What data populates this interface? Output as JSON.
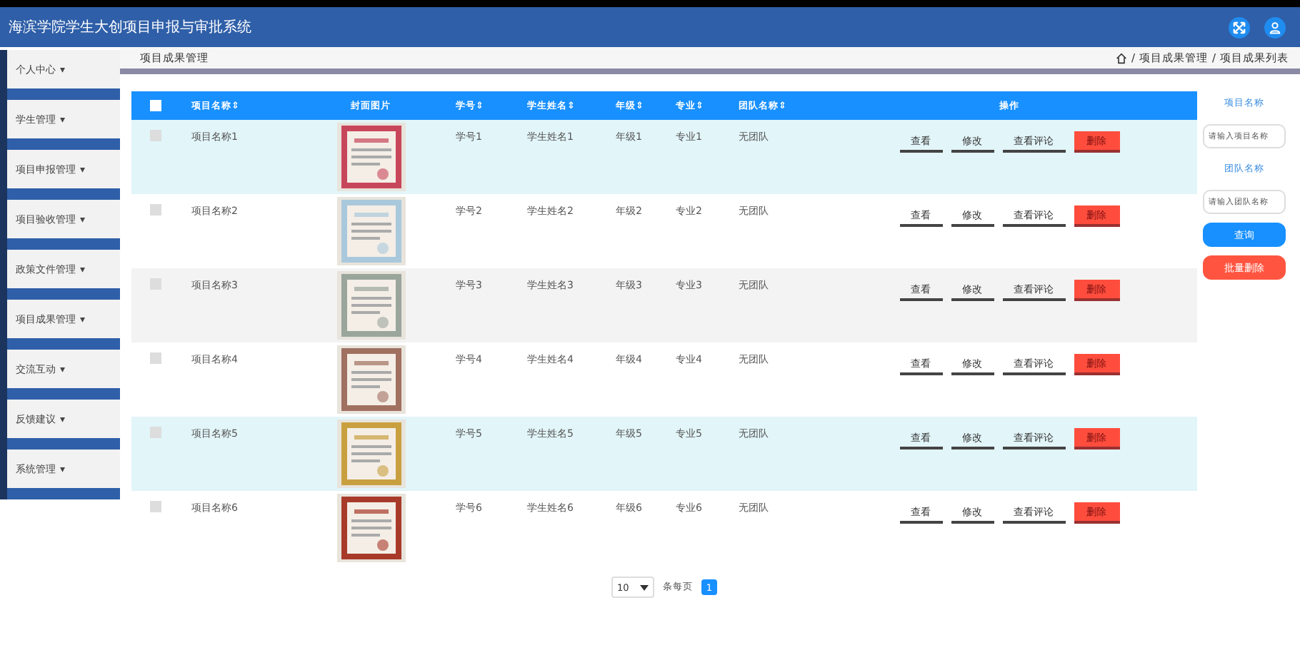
{
  "header": {
    "title": "海滨学院学生大创项目申报与审批系统"
  },
  "sidebar": {
    "items": [
      {
        "label": "个人中心",
        "caret": "▾"
      },
      {
        "label": "学生管理",
        "caret": "▾"
      },
      {
        "label": "项目申报管理",
        "caret": "▾"
      },
      {
        "label": "项目验收管理",
        "caret": "▾"
      },
      {
        "label": "政策文件管理",
        "caret": "▾"
      },
      {
        "label": "项目成果管理",
        "caret": "▾"
      },
      {
        "label": "交流互动",
        "caret": "▾"
      },
      {
        "label": "反馈建议",
        "caret": "▾"
      },
      {
        "label": "系统管理",
        "caret": "▾"
      }
    ]
  },
  "page_title": "项目成果管理",
  "breadcrumb": [
    {
      "separator": "/",
      "label": "项目成果管理"
    },
    {
      "separator": "/",
      "label": "项目成果列表"
    }
  ],
  "table": {
    "select_all_checked": false,
    "sort_mark": "⇕",
    "columns": [
      {
        "label": "项目名称",
        "sortable": true
      },
      {
        "label": "封面图片",
        "sortable": false
      },
      {
        "label": "学号",
        "sortable": true
      },
      {
        "label": "学生姓名",
        "sortable": true
      },
      {
        "label": "年级",
        "sortable": true
      },
      {
        "label": "专业",
        "sortable": true
      },
      {
        "label": "团队名称",
        "sortable": true
      },
      {
        "label": "操作",
        "sortable": false
      }
    ],
    "rows": [
      {
        "checked": false,
        "color": "#e2f5f9",
        "cells": [
          {
            "kind": "text",
            "text": "项目名称1"
          },
          {
            "kind": "picture"
          },
          {
            "kind": "text",
            "text": "学号1"
          },
          {
            "kind": "text",
            "text": "学生姓名1"
          },
          {
            "kind": "text",
            "text": "年级1"
          },
          {
            "kind": "text",
            "text": "专业1"
          },
          {
            "kind": "text",
            "text": "无团队"
          },
          {
            "kind": "actions",
            "buttons": [
              {
                "label": "查看",
                "kind": "plain"
              },
              {
                "label": "修改",
                "kind": "plain"
              },
              {
                "label": "查看评论",
                "kind": "plain"
              },
              {
                "label": "删除",
                "kind": "danger"
              }
            ]
          }
        ]
      },
      {
        "checked": false,
        "color": "#ffffff",
        "cells": [
          {
            "kind": "text",
            "text": "项目名称2"
          },
          {
            "kind": "picture"
          },
          {
            "kind": "text",
            "text": "学号2"
          },
          {
            "kind": "text",
            "text": "学生姓名2"
          },
          {
            "kind": "text",
            "text": "年级2"
          },
          {
            "kind": "text",
            "text": "专业2"
          },
          {
            "kind": "text",
            "text": "无团队"
          },
          {
            "kind": "actions",
            "buttons": [
              {
                "label": "查看",
                "kind": "plain"
              },
              {
                "label": "修改",
                "kind": "plain"
              },
              {
                "label": "查看评论",
                "kind": "plain"
              },
              {
                "label": "删除",
                "kind": "danger"
              }
            ]
          }
        ]
      },
      {
        "checked": false,
        "color": "#f3f3f3",
        "cells": [
          {
            "kind": "text",
            "text": "项目名称3"
          },
          {
            "kind": "picture"
          },
          {
            "kind": "text",
            "text": "学号3"
          },
          {
            "kind": "text",
            "text": "学生姓名3"
          },
          {
            "kind": "text",
            "text": "年级3"
          },
          {
            "kind": "text",
            "text": "专业3"
          },
          {
            "kind": "text",
            "text": "无团队"
          },
          {
            "kind": "actions",
            "buttons": [
              {
                "label": "查看",
                "kind": "plain"
              },
              {
                "label": "修改",
                "kind": "plain"
              },
              {
                "label": "查看评论",
                "kind": "plain"
              },
              {
                "label": "删除",
                "kind": "danger"
              }
            ]
          }
        ]
      },
      {
        "checked": false,
        "color": "#ffffff",
        "cells": [
          {
            "kind": "text",
            "text": "项目名称4"
          },
          {
            "kind": "picture"
          },
          {
            "kind": "text",
            "text": "学号4"
          },
          {
            "kind": "text",
            "text": "学生姓名4"
          },
          {
            "kind": "text",
            "text": "年级4"
          },
          {
            "kind": "text",
            "text": "专业4"
          },
          {
            "kind": "text",
            "text": "无团队"
          },
          {
            "kind": "actions",
            "buttons": [
              {
                "label": "查看",
                "kind": "plain"
              },
              {
                "label": "修改",
                "kind": "plain"
              },
              {
                "label": "查看评论",
                "kind": "plain"
              },
              {
                "label": "删除",
                "kind": "danger"
              }
            ]
          }
        ]
      },
      {
        "checked": false,
        "color": "#e2f5f9",
        "cells": [
          {
            "kind": "text",
            "text": "项目名称5"
          },
          {
            "kind": "picture"
          },
          {
            "kind": "text",
            "text": "学号5"
          },
          {
            "kind": "text",
            "text": "学生姓名5"
          },
          {
            "kind": "text",
            "text": "年级5"
          },
          {
            "kind": "text",
            "text": "专业5"
          },
          {
            "kind": "text",
            "text": "无团队"
          },
          {
            "kind": "actions",
            "buttons": [
              {
                "label": "查看",
                "kind": "plain"
              },
              {
                "label": "修改",
                "kind": "plain"
              },
              {
                "label": "查看评论",
                "kind": "plain"
              },
              {
                "label": "删除",
                "kind": "danger"
              }
            ]
          }
        ]
      },
      {
        "checked": false,
        "color": "#ffffff",
        "cells": [
          {
            "kind": "text",
            "text": "项目名称6"
          },
          {
            "kind": "picture"
          },
          {
            "kind": "text",
            "text": "学号6"
          },
          {
            "kind": "text",
            "text": "学生姓名6"
          },
          {
            "kind": "text",
            "text": "年级6"
          },
          {
            "kind": "text",
            "text": "专业6"
          },
          {
            "kind": "text",
            "text": "无团队"
          },
          {
            "kind": "actions",
            "buttons": [
              {
                "label": "查看",
                "kind": "plain"
              },
              {
                "label": "修改",
                "kind": "plain"
              },
              {
                "label": "查看评论",
                "kind": "plain"
              },
              {
                "label": "删除",
                "kind": "danger"
              }
            ]
          }
        ]
      }
    ]
  },
  "search": {
    "fields": [
      {
        "label": "项目名称",
        "placeholder": "请输入项目名称"
      },
      {
        "label": "团队名称",
        "placeholder": "请输入团队名称"
      }
    ],
    "buttons": [
      {
        "label": "查询",
        "kind": "primary"
      },
      {
        "label": "批量删除",
        "kind": "danger"
      }
    ]
  },
  "pagination": {
    "page_size": "10",
    "page_size_label": "条每页",
    "pages": [
      {
        "label": "1",
        "selected": true
      }
    ]
  }
}
